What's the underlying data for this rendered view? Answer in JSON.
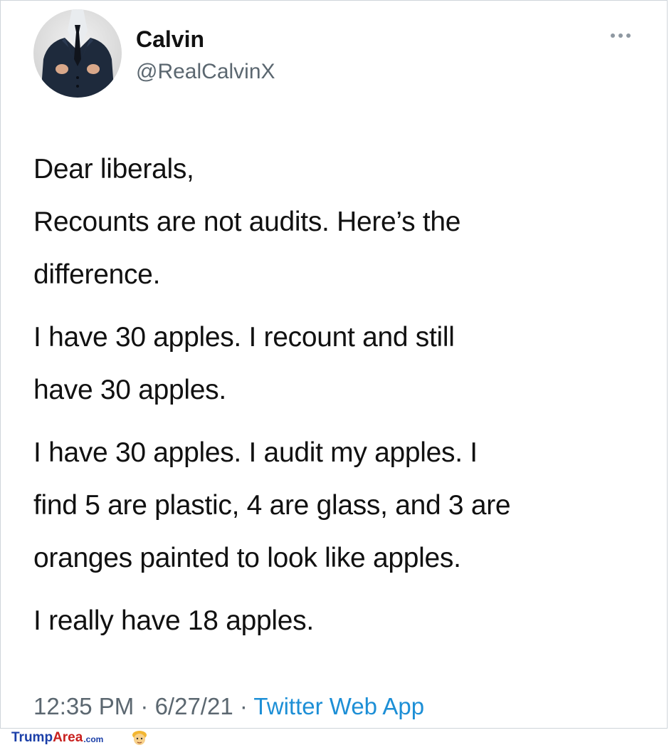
{
  "tweet": {
    "author": {
      "display_name": "Calvin",
      "handle": "@RealCalvinX"
    },
    "body": [
      "Dear liberals,\nRecounts are not audits. Here’s the\ndifference.",
      "I have 30 apples. I recount and still\nhave 30 apples.",
      "I have 30 apples. I audit my apples. I\nfind 5 are plastic, 4 are glass, and 3 are\noranges painted to look like apples.",
      "I really have 18 apples."
    ],
    "time": "12:35 PM",
    "date": "6/27/21",
    "separator": " · ",
    "source": "Twitter Web App"
  },
  "icons": {
    "more": "more-horizontal-icon"
  },
  "watermark": {
    "part1": "Trump",
    "part2": "Area",
    "part3": ".com"
  },
  "colors": {
    "text": "#111111",
    "secondary": "#5b6770",
    "link": "#1d8fd6",
    "border": "#cfd5da"
  }
}
